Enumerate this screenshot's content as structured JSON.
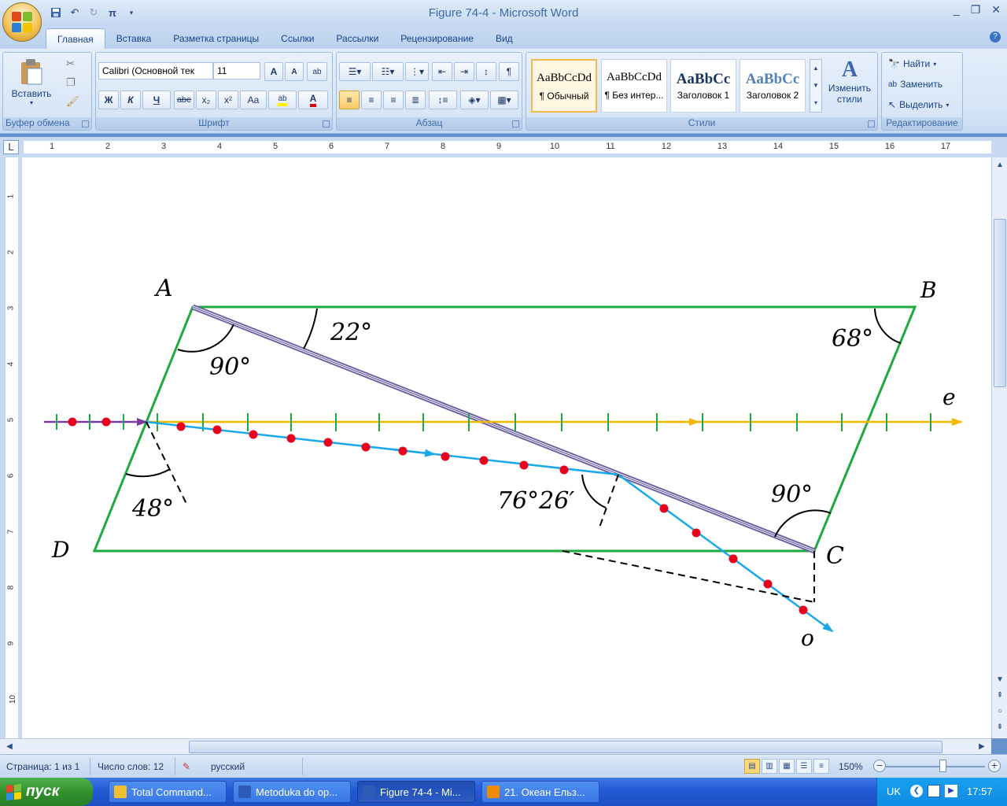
{
  "window": {
    "title": "Figure 74-4 - Microsoft Word",
    "controls": [
      "_",
      "❐",
      "✕"
    ]
  },
  "qat": {
    "items": [
      "save-icon",
      "undo-icon",
      "redo-icon",
      "pi-equation-icon",
      "customize-icon"
    ],
    "pi_label": "π"
  },
  "tabs": [
    "Главная",
    "Вставка",
    "Разметка страницы",
    "Ссылки",
    "Рассылки",
    "Рецензирование",
    "Вид"
  ],
  "ribbon": {
    "clipboard": {
      "paste_label": "Вставить",
      "group_label": "Буфер обмена"
    },
    "font": {
      "font_name": "Calibri (Основной тек",
      "font_size": "11",
      "group_label": "Шрифт",
      "bold": "Ж",
      "italic": "К",
      "underline": "Ч",
      "strike": "abe",
      "subscript": "x₂",
      "superscript": "x²",
      "case": "Aa",
      "grow": "A",
      "shrink": "A"
    },
    "paragraph": {
      "group_label": "Абзац",
      "pilcrow": "¶"
    },
    "styles": {
      "group_label": "Стили",
      "items": [
        {
          "sample": "AaBbCcDd",
          "name": "¶ Обычный",
          "color": "#000000"
        },
        {
          "sample": "AaBbCcDd",
          "name": "¶ Без интер...",
          "color": "#000000"
        },
        {
          "sample": "AaBbCc",
          "name": "Заголовок 1",
          "color": "#17365d"
        },
        {
          "sample": "AaBbCc",
          "name": "Заголовок 2",
          "color": "#4f81bd"
        }
      ],
      "change_label_1": "Изменить",
      "change_label_2": "стили"
    },
    "editing": {
      "group_label": "Редактирование",
      "find": "Найти",
      "replace": "Заменить",
      "select": "Выделить"
    }
  },
  "ruler": {
    "h_numbers": [
      "1",
      "2",
      "3",
      "4",
      "5",
      "6",
      "7",
      "8",
      "9",
      "10",
      "11",
      "12",
      "13",
      "14",
      "15",
      "16",
      "17"
    ],
    "v_numbers": [
      "1",
      "2",
      "3",
      "4",
      "5",
      "6",
      "7",
      "8",
      "9",
      "10"
    ],
    "corner": "L"
  },
  "figure": {
    "labels": {
      "A": "A",
      "B": "B",
      "C": "C",
      "D": "D",
      "e": "e",
      "o": "o"
    },
    "angles": {
      "a_top": "22°",
      "a_corner": "90°",
      "b_corner": "68°",
      "entry": "48°",
      "exit": "76°26′",
      "c_corner": "90°"
    },
    "colors": {
      "frame": "#1faa3c",
      "axis": "#f5b800",
      "ray": "#19a9e8",
      "dots": "#e8001c",
      "incoming": "#7b3aa0",
      "diagonal": "#7060a8",
      "dashes": "#000000"
    }
  },
  "status": {
    "page": "Страница: 1 из 1",
    "words": "Число слов: 12",
    "language": "русский",
    "zoom": "150%"
  },
  "taskbar": {
    "start": "пуск",
    "tasks": [
      {
        "label": "Total Command...",
        "icon_color": "#f0c030"
      },
      {
        "label": "Metoduka do op...",
        "icon_color": "#2f5bb8"
      },
      {
        "label": "Figure 74-4 - Mi...",
        "icon_color": "#2f5bb8"
      },
      {
        "label": "21. Океан Ельз...",
        "icon_color": "#f08a00"
      }
    ],
    "lang": "UK",
    "clock": "17:57"
  }
}
